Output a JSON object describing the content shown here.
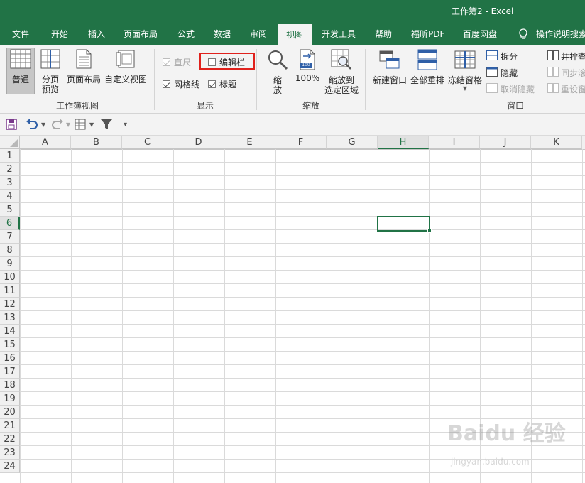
{
  "window": {
    "title": "工作簿2  -  Excel"
  },
  "tabs": [
    {
      "label": "文件"
    },
    {
      "label": "开始"
    },
    {
      "label": "插入"
    },
    {
      "label": "页面布局"
    },
    {
      "label": "公式"
    },
    {
      "label": "数据"
    },
    {
      "label": "审阅"
    },
    {
      "label": "视图"
    },
    {
      "label": "开发工具"
    },
    {
      "label": "帮助"
    },
    {
      "label": "福昕PDF"
    },
    {
      "label": "百度网盘"
    }
  ],
  "active_tab": "视图",
  "tell_me": {
    "label": "操作说明搜索"
  },
  "ribbon": {
    "workbook_views": {
      "label": "工作簿视图",
      "normal": "普通",
      "page_break_line1": "分页",
      "page_break_line2": "预览",
      "page_layout": "页面布局",
      "custom_views": "自定义视图"
    },
    "show": {
      "label": "显示",
      "ruler": {
        "label": "直尺",
        "checked": true,
        "enabled": false
      },
      "formula_bar": {
        "label": "编辑栏",
        "checked": false
      },
      "gridlines": {
        "label": "网格线",
        "checked": true
      },
      "headings": {
        "label": "标题",
        "checked": true
      }
    },
    "zoom": {
      "label": "缩放",
      "zoom_line1": "缩",
      "zoom_line2": "放",
      "zoom_100": "100%",
      "zoom_sel_line1": "缩放到",
      "zoom_sel_line2": "选定区域",
      "badge": "100"
    },
    "window": {
      "label": "窗口",
      "new_window": "新建窗口",
      "arrange_all": "全部重排",
      "freeze_panes": "冻结窗格",
      "split": "拆分",
      "hide": "隐藏",
      "unhide": "取消隐藏",
      "side_by_side": "并排查",
      "sync_scroll": "同步滚",
      "reset_position": "重设窗"
    }
  },
  "qat": {
    "more": "▾"
  },
  "sheet": {
    "columns": [
      "A",
      "B",
      "C",
      "D",
      "E",
      "F",
      "G",
      "H",
      "I",
      "J",
      "K"
    ],
    "rows": [
      "1",
      "2",
      "3",
      "4",
      "5",
      "6",
      "7",
      "8",
      "9",
      "10",
      "11",
      "12",
      "13",
      "14",
      "15",
      "16",
      "17",
      "18",
      "19",
      "20",
      "21",
      "22",
      "23",
      "24"
    ],
    "active_cell": "H6"
  },
  "watermark": {
    "brand": "Baidu 经验",
    "url": "jingyan.baidu.com"
  },
  "colors": {
    "accent": "#217346",
    "highlight_box": "#e0211c"
  }
}
